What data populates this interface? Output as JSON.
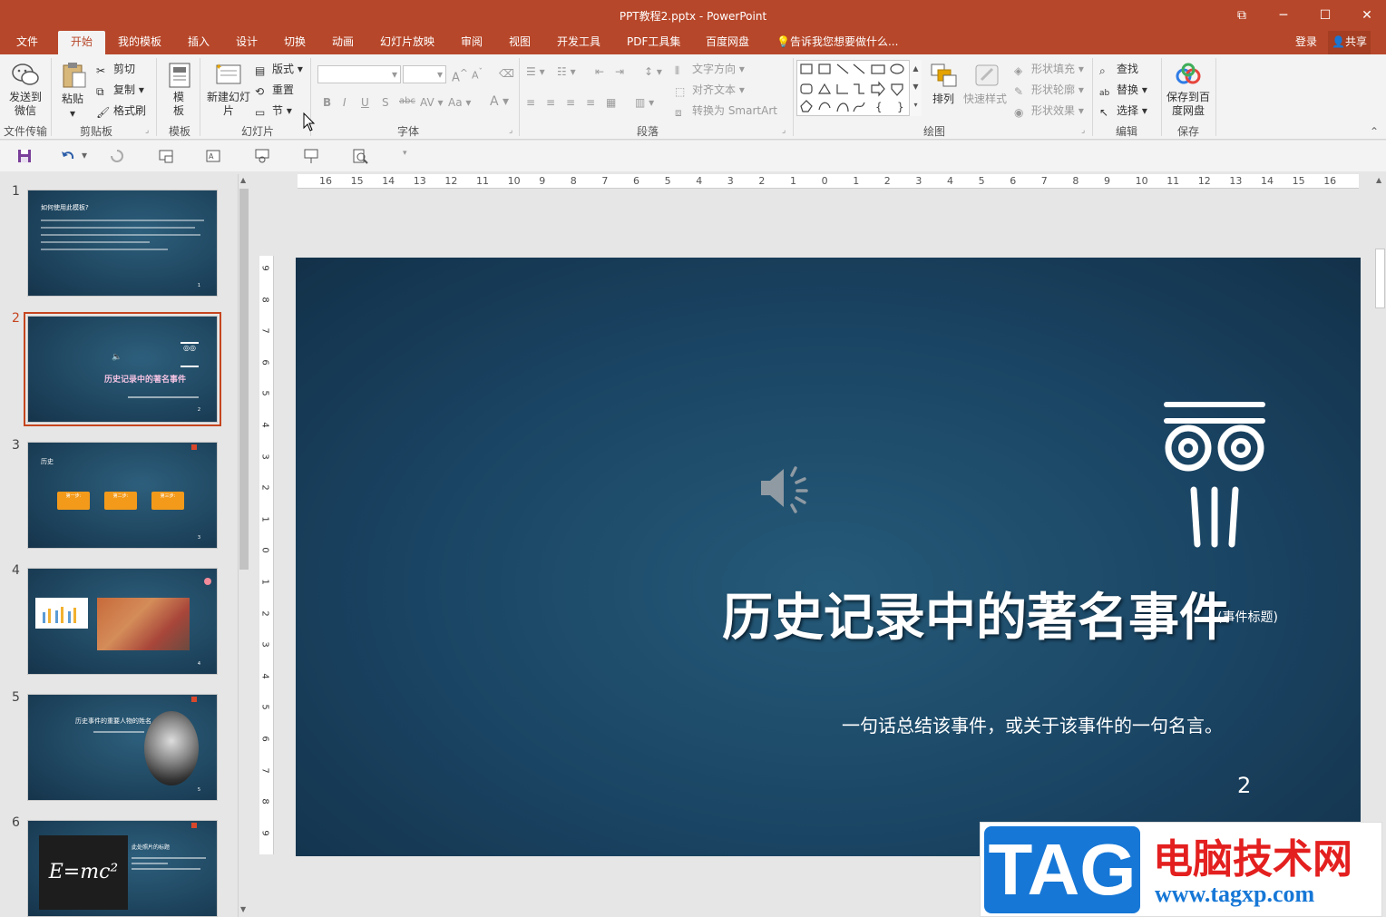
{
  "window": {
    "title": "PPT教程2.pptx - PowerPoint"
  },
  "tabs": [
    "文件",
    "开始",
    "我的模板",
    "插入",
    "设计",
    "切换",
    "动画",
    "幻灯片放映",
    "审阅",
    "视图",
    "开发工具",
    "PDF工具集",
    "百度网盘"
  ],
  "tell_me": "告诉我您想要做什么...",
  "account": {
    "login": "登录",
    "share": "共享"
  },
  "ribbon": {
    "send_wechat": "发送到微信",
    "file_transfer": "文件传输",
    "paste": "粘贴",
    "cut": "剪切",
    "copy": "复制",
    "format_painter": "格式刷",
    "clipboard": "剪贴板",
    "template": "模板",
    "template_group": "模板",
    "new_slide": "新建幻灯片",
    "layout": "版式",
    "reset": "重置",
    "section": "节",
    "slides_group": "幻灯片",
    "font_group": "字体",
    "paragraph_group": "段落",
    "text_direction": "文字方向",
    "align_text": "对齐文本",
    "smartart": "转换为 SmartArt",
    "arrange": "排列",
    "quick_styles": "快速样式",
    "shape_fill": "形状填充",
    "shape_outline": "形状轮廓",
    "shape_effects": "形状效果",
    "drawing_group": "绘图",
    "find": "查找",
    "replace": "替换",
    "select": "选择",
    "editing_group": "编辑",
    "save_baidu": "保存到百度网盘",
    "save_group": "保存"
  },
  "thumbs": [
    {
      "num": "1",
      "title": "如何使用此模板?",
      "page": "1"
    },
    {
      "num": "2",
      "title": "历史记录中的著名事件",
      "page": "2"
    },
    {
      "num": "3",
      "title": "历史",
      "steps": [
        "第一步:",
        "第二步:",
        "第三步:"
      ],
      "page": "3"
    },
    {
      "num": "4",
      "page": "4"
    },
    {
      "num": "5",
      "title": "历史事件的重要人物的姓名",
      "page": "5"
    },
    {
      "num": "6",
      "title": "此处照片的标题",
      "eq": "E=mc²"
    }
  ],
  "slide": {
    "title": "历史记录中的著名事件",
    "tag": "(事件标题)",
    "subtitle": "一句话总结该事件，或关于该事件的一句名言。",
    "page": "2"
  },
  "ruler": {
    "h": [
      "16",
      "15",
      "14",
      "13",
      "12",
      "11",
      "10",
      "9",
      "8",
      "7",
      "6",
      "5",
      "4",
      "3",
      "2",
      "1",
      "0",
      "1",
      "2",
      "3",
      "4",
      "5",
      "6",
      "7",
      "8",
      "9",
      "10",
      "11",
      "12",
      "13",
      "14",
      "15",
      "16"
    ],
    "v": [
      "9",
      "8",
      "7",
      "6",
      "5",
      "4",
      "3",
      "2",
      "1",
      "0",
      "1",
      "2",
      "3",
      "4",
      "5",
      "6",
      "7",
      "8",
      "9"
    ]
  },
  "watermark": {
    "tag": "TAG",
    "cn": "电脑技术网",
    "url": "www.tagxp.com"
  }
}
